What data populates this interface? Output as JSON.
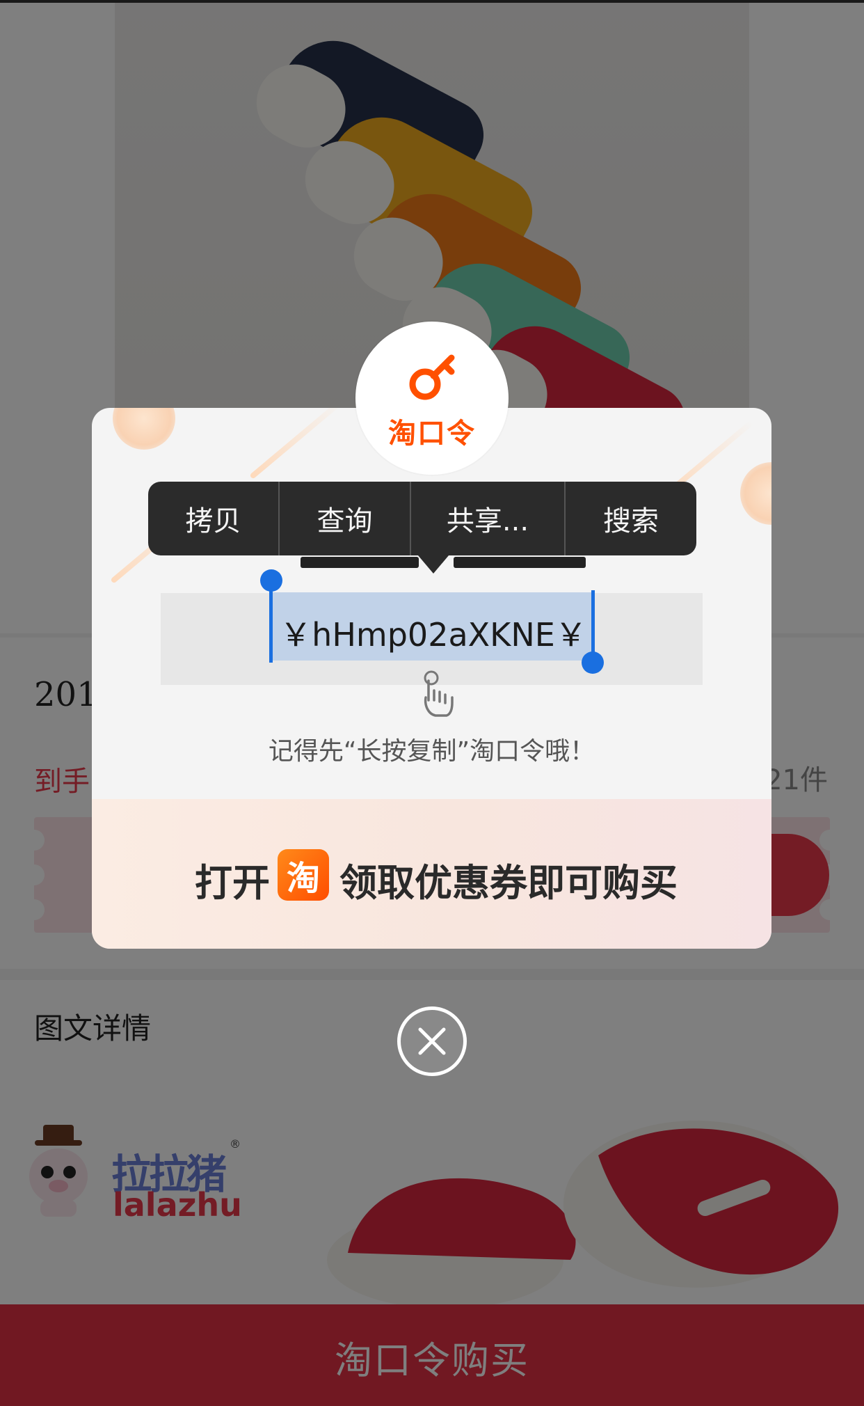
{
  "page": {
    "product_title_partial": "201",
    "price_label_partial": "到手",
    "sales_count_partial": "21件",
    "detail_heading": "图文详情",
    "brand": {
      "name_cn": "拉拉猪",
      "name_en": "lalazhu",
      "reg_mark": "®"
    },
    "buy_bar_label": "淘口令购买"
  },
  "modal": {
    "badge_label": "淘口令",
    "code_text": "￥hHmp02aXKNE￥",
    "hint": "记得先“长按复制”淘口令哦！",
    "footer": {
      "before_badge": "打开",
      "badge_char": "淘",
      "after_badge": "领取优惠券即可购买"
    }
  },
  "callout_menu": {
    "items": [
      "拷贝",
      "查询",
      "共享...",
      "搜索"
    ]
  },
  "colors": {
    "brand_orange": "#ff5000",
    "accent_red": "#e23145",
    "selection_blue": "#1a6fe0",
    "selection_fill": "#c1d2e8"
  },
  "icons": {
    "key": "key-icon",
    "hand": "hand-pointer-icon",
    "close": "close-icon"
  }
}
